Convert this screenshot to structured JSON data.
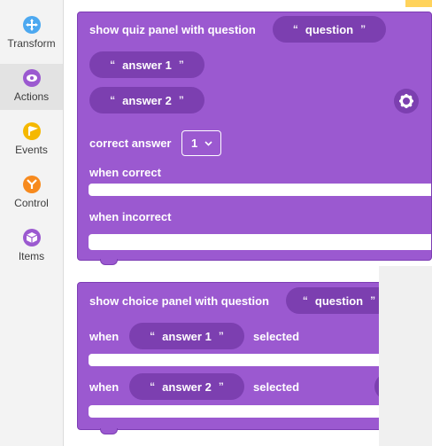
{
  "sidebar": {
    "items": [
      {
        "label": "Transform",
        "color": "#4ca8f0",
        "icon": "move-arrows-icon"
      },
      {
        "label": "Actions",
        "color": "#9b59d0",
        "icon": "eye-icon"
      },
      {
        "label": "Events",
        "color": "#f5b800",
        "icon": "flag-icon"
      },
      {
        "label": "Control",
        "color": "#f78a1e",
        "icon": "branch-icon"
      },
      {
        "label": "Items",
        "color": "#9b59d0",
        "icon": "cube-icon"
      }
    ],
    "active_index": 1
  },
  "quiz_block": {
    "title": "show quiz panel with question",
    "question": "question",
    "answer1": "answer 1",
    "answer2": "answer 2",
    "correct_label": "correct answer",
    "correct_value": "1",
    "when_correct": "when correct",
    "when_incorrect": "when incorrect",
    "quote": "“",
    "quote_close": "”"
  },
  "choice_block": {
    "title": "show choice panel with question",
    "question": "question",
    "when": "when",
    "answer1": "answer 1",
    "answer2": "answer 2",
    "selected": "selected",
    "quote": "“",
    "quote_close": "”"
  },
  "colors": {
    "block": "#9b59d0",
    "block_dark": "#7c3fb0"
  }
}
